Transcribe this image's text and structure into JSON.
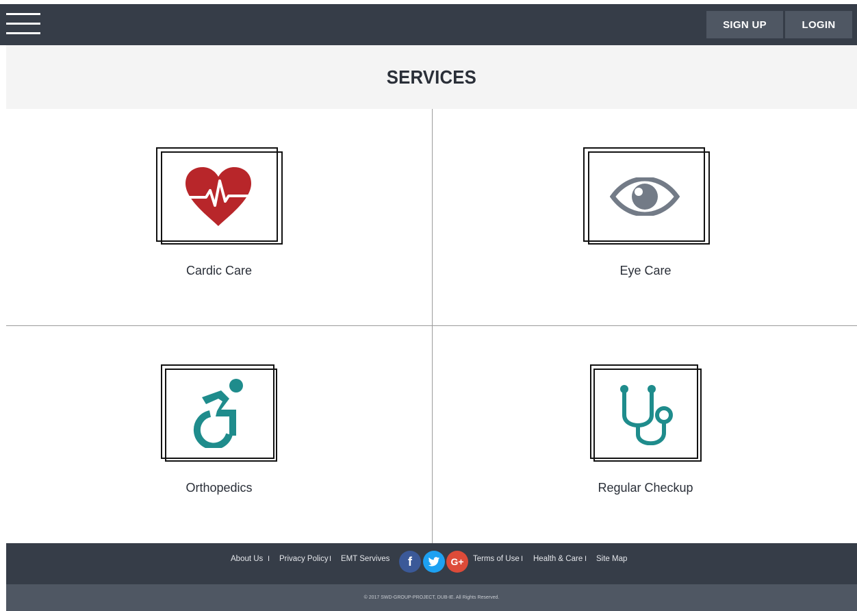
{
  "header": {
    "menu_icon": "hamburger-menu-icon",
    "signup_label": "SIGN UP",
    "login_label": "LOGIN"
  },
  "page": {
    "title": "SERVICES"
  },
  "services": [
    {
      "label": "Cardic Care",
      "icon": "heartbeat-icon",
      "color": "#b8262a"
    },
    {
      "label": "Eye Care",
      "icon": "eye-icon",
      "color": "#737b87"
    },
    {
      "label": "Orthopedics",
      "icon": "accessible-wheelchair-icon",
      "color": "#1f8c8c"
    },
    {
      "label": "Regular Checkup",
      "icon": "stethoscope-icon",
      "color": "#1f8c8c"
    }
  ],
  "footer": {
    "links_left": [
      "About Us",
      "Privacy Policy",
      "EMT Servives"
    ],
    "links_right": [
      "Terms of Use",
      "Health & Care",
      "Site Map"
    ],
    "separator": "I",
    "social": [
      {
        "name": "facebook",
        "glyph": "f",
        "color": "#3b5998"
      },
      {
        "name": "twitter",
        "glyph": "t",
        "color": "#1da1f2"
      },
      {
        "name": "google-plus",
        "glyph": "G+",
        "color": "#dd4b39"
      }
    ],
    "copyright": "© 2017 SWD-GROUP-PROJECT, DUB-IE. All Rights Reserved."
  },
  "colors": {
    "nav_bg": "#363d48",
    "button_bg": "#4f5763",
    "title_band_bg": "#f4f4f4"
  }
}
